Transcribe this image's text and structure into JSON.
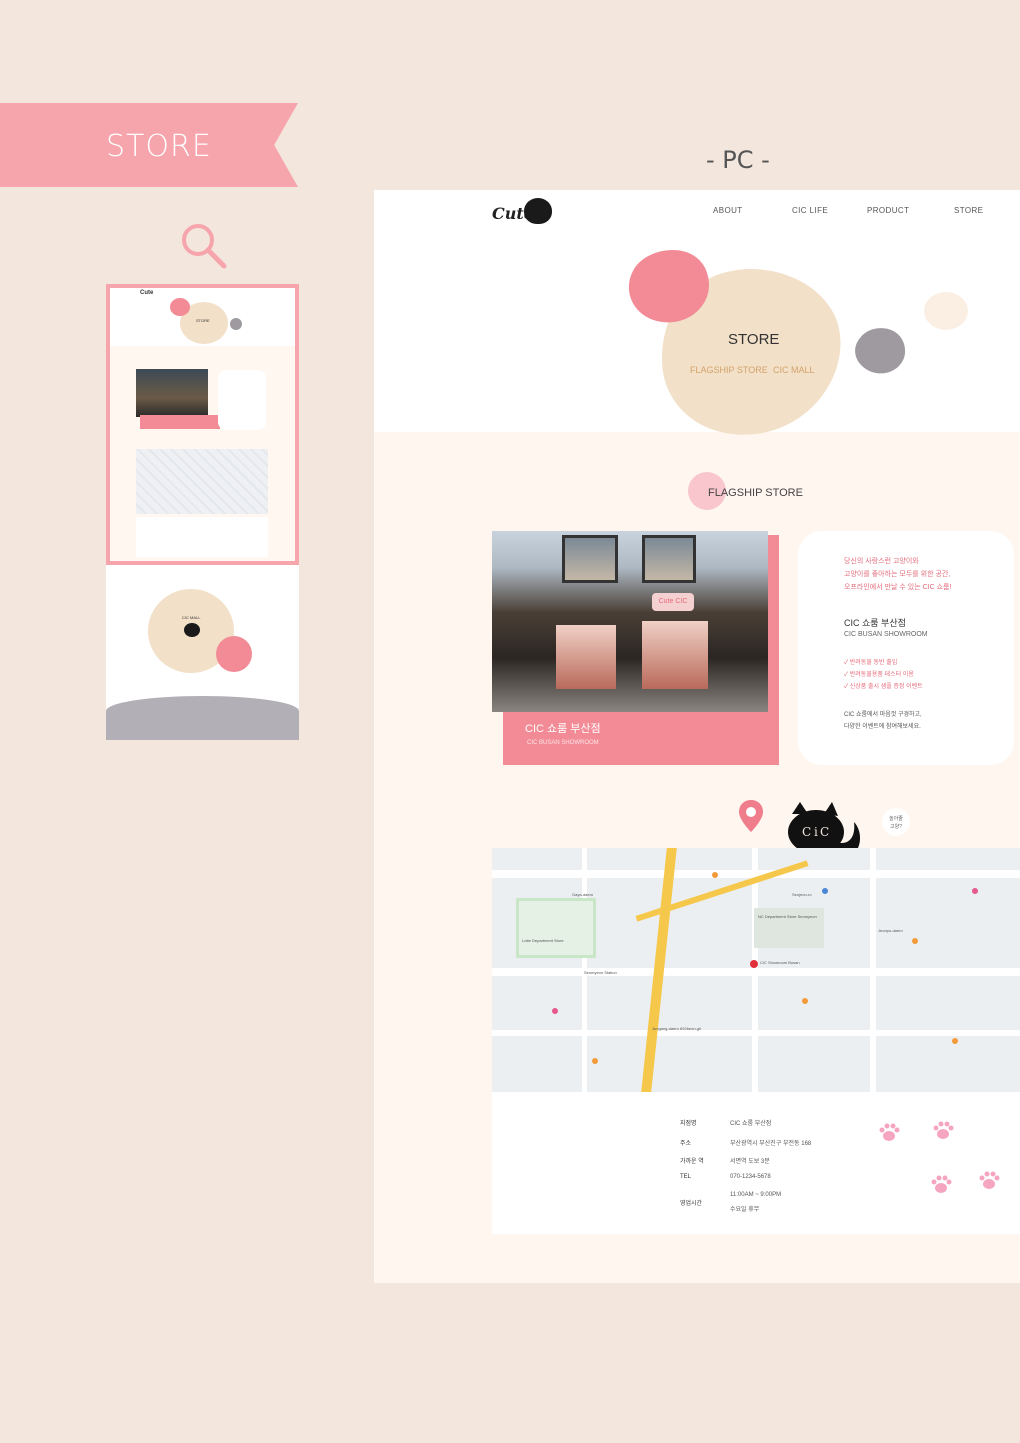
{
  "header": {
    "ribbon_title": "STORE",
    "pc_label": "- PC -"
  },
  "nav": {
    "logo": "Cute",
    "items": [
      "ABOUT",
      "CIC LIFE",
      "PRODUCT",
      "STORE"
    ]
  },
  "hero": {
    "title": "STORE",
    "links": [
      "FLAGSHIP STORE",
      "CIC MALL"
    ]
  },
  "flagship": {
    "section_title": "FLAGSHIP STORE",
    "store_name_ko": "CIC 쇼룸 부산점",
    "store_name_en": "CIC BUSAN SHOWROOM",
    "sign_text": "Cute CIC"
  },
  "card": {
    "intro_lines": [
      "당신의 사랑스런 고양이와",
      "고양이를 좋아하는 모두를 위한 공간,",
      "오프라인에서 만날 수 있는 CIC 쇼룸!"
    ],
    "name_ko": "CIC 쇼룸 부산점",
    "name_en": "CIC BUSAN SHOWROOM",
    "checks": [
      "반려동물 동반 출입",
      "반려동물용품 테스터 이용",
      "신상품 출시 샘플 증정 이벤트"
    ],
    "tail_lines": [
      "CIC 쇼룸에서 마음껏 구경하고,",
      "다양한 이벤트에 참여해보세요."
    ]
  },
  "cat_bubble": [
    "놀아줄",
    "고양?"
  ],
  "info": {
    "rows": [
      {
        "k": "지점명",
        "v": "CIC 쇼룸 부산점"
      },
      {
        "k": "주소",
        "v": "부산광역시 부산진구 부전동 168"
      },
      {
        "k": "가까운 역",
        "v": "서면역 도보 3분"
      },
      {
        "k": "TEL",
        "v": "070-1234-5678"
      },
      {
        "k": "영업시간",
        "v": "11:00AM ~ 9:00PM"
      }
    ],
    "hours_extra": "수요일 휴무"
  },
  "map": {
    "labels": [
      "Lotte Department Store",
      "Seomyeon Station",
      "NC Department Store Seomyeon",
      "Jeonpo-daero",
      "Jungang-daero 692beon-gil",
      "Gaya-daero",
      "Seojeon-ro",
      "CIC Showroom Busan"
    ]
  },
  "thumb": {
    "hero_title": "STORE",
    "mall_title": "CIC MALL"
  },
  "colors": {
    "accent": "#f28b96",
    "ribbon": "#f6a5ad",
    "cream": "#f2e0c8",
    "gray_blob": "#9e9aa0",
    "bg": "#f3e6dd",
    "gold": "#d4a36a"
  }
}
